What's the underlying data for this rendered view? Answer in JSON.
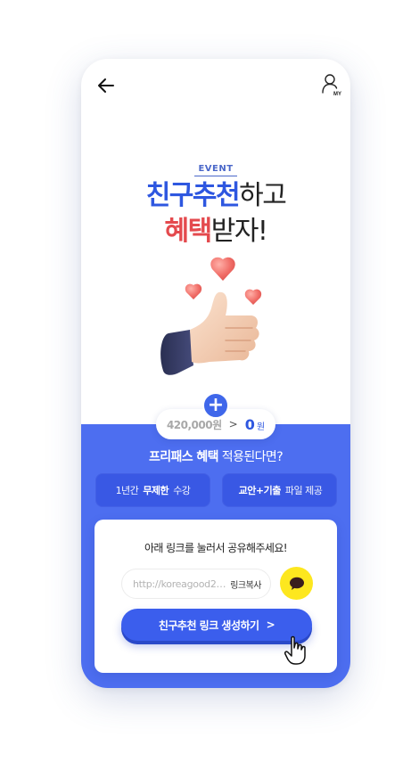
{
  "header": {
    "back_icon": "arrow-left-icon",
    "my_icon": "user-my-icon",
    "my_label": "MY"
  },
  "hero": {
    "event_label": "EVENT",
    "line1_highlight": "친구추천",
    "line1_rest": "하고",
    "line2_highlight": "혜택",
    "line2_rest": "받자!"
  },
  "price": {
    "plus": "+",
    "old_price": "420,000원",
    "arrow": ">",
    "new_price": "0",
    "new_price_unit": "원"
  },
  "benefits": {
    "title_bold": "프리패스 혜택",
    "title_rest": "적용된다면?",
    "items": [
      {
        "pre": "1년간",
        "bold": "무제한",
        "post": "수강"
      },
      {
        "pre": "",
        "bold": "교안+기출",
        "post": "파일 제공"
      }
    ]
  },
  "share": {
    "instruction": "아래 링크를 눌러서 공유해주세요!",
    "link_placeholder": "http://koreagood22...",
    "copy_label": "링크복사",
    "kakao_icon": "kakaotalk-icon",
    "generate_label": "친구추천 링크 생성하기",
    "generate_chevron": ">"
  },
  "colors": {
    "primary": "#2e57e0",
    "accent_red": "#e44a4e",
    "section_blue": "#4d6ef0",
    "kakao_yellow": "#fde71f"
  }
}
